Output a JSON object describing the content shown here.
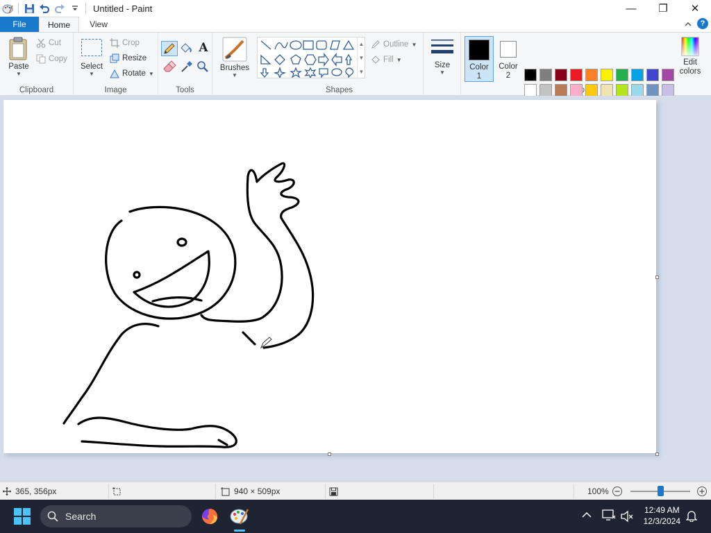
{
  "window": {
    "title": "Untitled - Paint",
    "controls": {
      "minimize": "—",
      "maximize": "❐",
      "close": "✕"
    }
  },
  "tabs": {
    "file": "File",
    "home": "Home",
    "view": "View",
    "help": "?"
  },
  "ribbon": {
    "clipboard": {
      "label": "Clipboard",
      "paste": "Paste",
      "cut": "Cut",
      "copy": "Copy"
    },
    "image": {
      "label": "Image",
      "select": "Select",
      "crop": "Crop",
      "resize": "Resize",
      "rotate": "Rotate"
    },
    "tools": {
      "label": "Tools",
      "text_glyph": "A"
    },
    "brushes": {
      "label": "Brushes"
    },
    "shapes": {
      "label": "Shapes",
      "outline": "Outline",
      "fill": "Fill"
    },
    "size": {
      "label": "Size"
    },
    "color1": {
      "label": "Color",
      "num": "1",
      "value": "#000000"
    },
    "color2": {
      "label": "Color",
      "num": "2",
      "value": "#ffffff"
    },
    "colors": {
      "label": "Colors",
      "edit_label_1": "Edit",
      "edit_label_2": "colors",
      "row1": [
        "#000000",
        "#7f7f7f",
        "#880015",
        "#ed1c24",
        "#ff7f27",
        "#fff200",
        "#22b14c",
        "#00a2e8",
        "#3f48cc",
        "#a349a4"
      ],
      "row2": [
        "#ffffff",
        "#c3c3c3",
        "#b97a57",
        "#ffaec9",
        "#ffc90e",
        "#efe4b0",
        "#b5e61d",
        "#99d9ea",
        "#7092be",
        "#c8bfe7"
      ]
    }
  },
  "status": {
    "cursor_pos": "365, 356px",
    "canvas_size": "940 × 509px",
    "zoom": "100%",
    "zoom_level": 1.0
  },
  "taskbar": {
    "search": "Search",
    "time": "12:49 AM",
    "date": "12/3/2024"
  },
  "accent": "#1979ca"
}
